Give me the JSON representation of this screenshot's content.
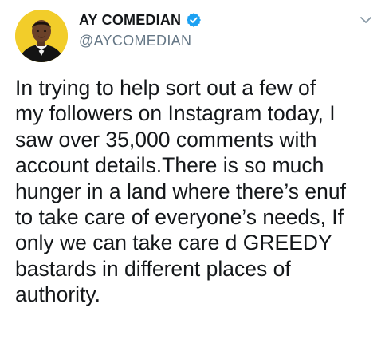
{
  "tweet": {
    "author": {
      "display_name": "AY COMEDIAN",
      "handle": "@AYCOMEDIAN",
      "verified": true
    },
    "text": "In trying to help sort out a few of\nmy followers on Instagram today, I\nsaw over 35,000 comments with\naccount details.There is so much\nhunger in a land where there’s enuf\nto take care of everyone’s needs, If\nonly we can take care d GREEDY\nbastards in different places of\nauthority.",
    "icons": {
      "verified": "verified-badge-icon",
      "menu": "chevron-down-icon"
    }
  },
  "colors": {
    "text": "#14171a",
    "secondary": "#657786",
    "verified": "#1da1f2",
    "avatar_bg": "#f2cd2a"
  }
}
